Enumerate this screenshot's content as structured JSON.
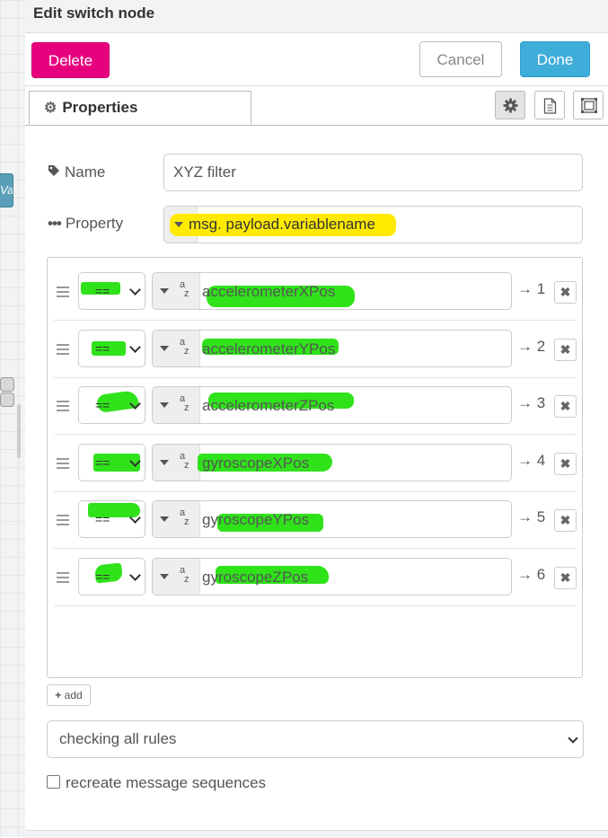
{
  "canvas": {
    "node_label": "Va"
  },
  "dialog": {
    "title": "Edit switch node",
    "buttons": {
      "delete": "Delete",
      "cancel": "Cancel",
      "done": "Done"
    },
    "tabs": {
      "properties": "Properties"
    },
    "fields": {
      "name_label": "Name",
      "name_value": "XYZ filter",
      "property_label": "Property",
      "property_value": "msg. payload.variablename"
    },
    "rules": [
      {
        "operator": "==",
        "value": "accelerometerXPos",
        "output": "→ 1"
      },
      {
        "operator": "==",
        "value": "accelerometerYPos",
        "output": "→ 2"
      },
      {
        "operator": "==",
        "value": "accelerometerZPos",
        "output": "→ 3"
      },
      {
        "operator": "==",
        "value": "gyroscopeXPos",
        "output": "→ 4"
      },
      {
        "operator": "==",
        "value": "gyroscopeYPos",
        "output": "→ 5"
      },
      {
        "operator": "==",
        "value": "gyroscopeZPos",
        "output": "→ 6"
      }
    ],
    "add_label": "add",
    "checking_mode": "checking all rules",
    "recreate_label": "recreate message sequences"
  },
  "colors": {
    "delete": "#e6007e",
    "done": "#3fadda",
    "highlight_yellow": "#ffea00",
    "highlight_green": "#2fe21a"
  },
  "icons": [
    "gear-icon",
    "document-icon",
    "frame-icon",
    "tag-icon",
    "ellipsis-icon",
    "drag-handle-icon",
    "close-icon",
    "plus-icon",
    "chevron-down-icon"
  ]
}
